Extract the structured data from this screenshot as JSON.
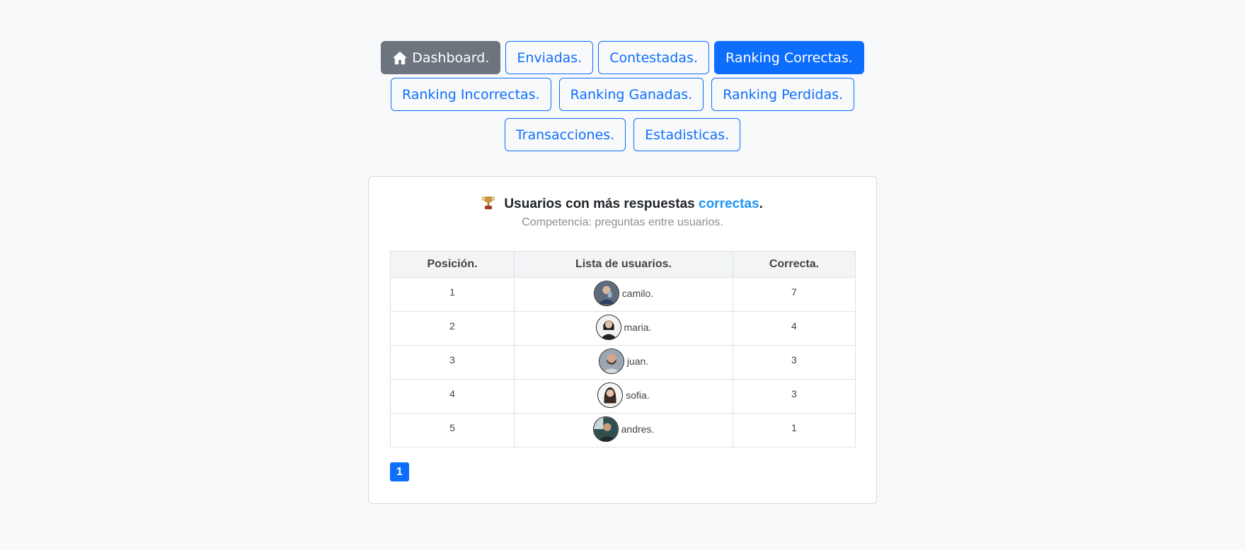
{
  "nav": {
    "dashboard": "Dashboard.",
    "enviadas": "Enviadas.",
    "contestadas": "Contestadas.",
    "ranking_correctas": "Ranking Correctas.",
    "ranking_incorrectas": "Ranking Incorrectas.",
    "ranking_ganadas": "Ranking Ganadas.",
    "ranking_perdidas": "Ranking Perdidas.",
    "transacciones": "Transacciones.",
    "estadisticas": "Estadisticas."
  },
  "card": {
    "title_main": "Usuarios con más respuestas ",
    "title_accent": "correctas",
    "title_end": ".",
    "subtitle": "Competencia: preguntas entre usuarios."
  },
  "table": {
    "headers": [
      "Posición.",
      "Lista de usuarios.",
      "Correcta."
    ],
    "rows": [
      {
        "pos": "1",
        "user": "camilo.",
        "value": "7"
      },
      {
        "pos": "2",
        "user": "maria.",
        "value": "4"
      },
      {
        "pos": "3",
        "user": "juan.",
        "value": "3"
      },
      {
        "pos": "4",
        "user": "sofia.",
        "value": "3"
      },
      {
        "pos": "5",
        "user": "andres.",
        "value": "1"
      }
    ]
  },
  "pagination": {
    "page": "1"
  },
  "colors": {
    "primary": "#0d6efd",
    "secondary": "#6c757d",
    "accent": "#2196f3"
  },
  "icons": {
    "dashboard": "home-icon",
    "title": "trophy-icon"
  }
}
